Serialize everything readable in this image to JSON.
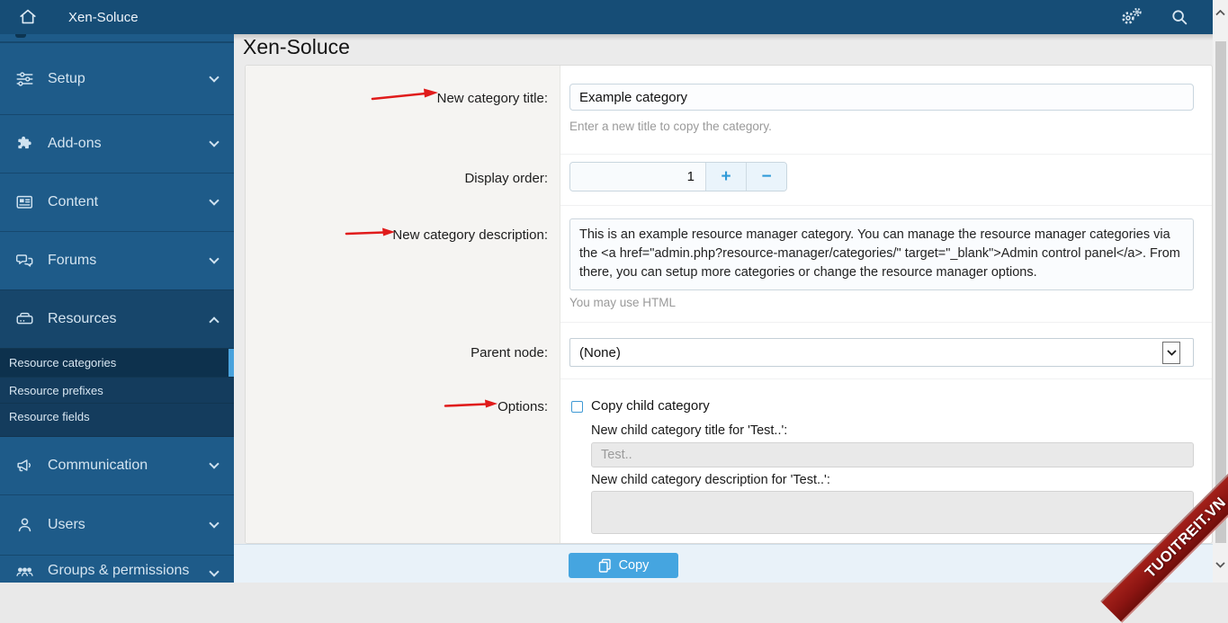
{
  "topbar": {
    "title": "Xen-Soluce"
  },
  "sidebar": {
    "items": [
      {
        "label": "Setup",
        "state": "collapsed"
      },
      {
        "label": "Add-ons",
        "state": "collapsed"
      },
      {
        "label": "Content",
        "state": "collapsed"
      },
      {
        "label": "Forums",
        "state": "collapsed"
      },
      {
        "label": "Resources",
        "state": "expanded"
      },
      {
        "label": "Communication",
        "state": "collapsed"
      },
      {
        "label": "Users",
        "state": "collapsed"
      },
      {
        "label": "Groups & permissions",
        "state": "collapsed"
      }
    ],
    "resources_subitems": [
      {
        "label": "Resource categories",
        "active": true
      },
      {
        "label": "Resource prefixes",
        "active": false
      },
      {
        "label": "Resource fields",
        "active": false
      }
    ]
  },
  "main": {
    "page_title": "Xen-Soluce",
    "form": {
      "title_row": {
        "label": "New category title:",
        "value": "Example category",
        "hint": "Enter a new title to copy the category."
      },
      "order_row": {
        "label": "Display order:",
        "value": "1",
        "plus": "+",
        "minus": "−"
      },
      "description_row": {
        "label": "New category description:",
        "value": "This is an example resource manager category. You can manage the resource manager categories via the <a href=\"admin.php?resource-manager/categories/\" target=\"_blank\">Admin control panel</a>. From there, you can setup more categories or change the resource manager options.",
        "hint": "You may use HTML"
      },
      "parent_row": {
        "label": "Parent node:",
        "value": "(None)"
      },
      "options_row": {
        "label": "Options:",
        "checkbox_label": "Copy child category",
        "child_title_label": "New child category title for 'Test..':",
        "child_title_placeholder": "Test..",
        "child_desc_label": "New child category description for 'Test..':"
      }
    },
    "footer": {
      "copy_button": "Copy"
    }
  },
  "watermark": {
    "text": "TUOITREIT.VN"
  },
  "colors": {
    "topbar": "#164d76",
    "sidebar": "#1e5b89",
    "sidebar_expanded": "#17466b",
    "active_indicator": "#4aa3dd",
    "accent": "#2e9ad8",
    "copy_button": "#45a5e0",
    "annotation_arrow": "#e01b1b",
    "ribbon": "#8c1512"
  }
}
